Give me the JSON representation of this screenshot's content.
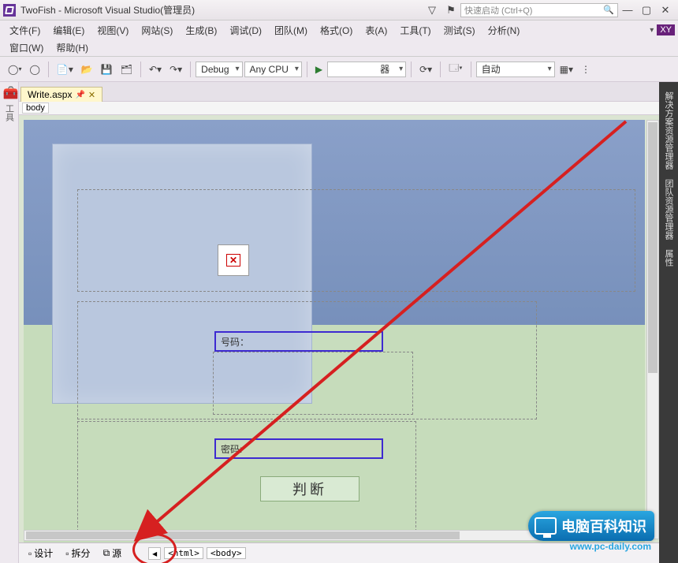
{
  "title": "TwoFish - Microsoft Visual Studio(管理员)",
  "quicklaunch_placeholder": "快速启动 (Ctrl+Q)",
  "menu": {
    "file": "文件(F)",
    "edit": "编辑(E)",
    "view": "视图(V)",
    "website": "网站(S)",
    "build": "生成(B)",
    "debug": "调试(D)",
    "team": "团队(M)",
    "format": "格式(O)",
    "table": "表(A)",
    "tools": "工具(T)",
    "test": "测试(S)",
    "analyze": "分析(N)",
    "window": "窗口(W)",
    "help": "帮助(H)"
  },
  "user_badge": "XY",
  "toolbar": {
    "config": "Debug",
    "platform": "Any CPU",
    "launch_suffix": "器",
    "auto": "自动"
  },
  "tab": {
    "name": "Write.aspx"
  },
  "breadcrumb": {
    "body": "body"
  },
  "form": {
    "number_label": "号码：",
    "password_label": "密码:",
    "submit_label": "判断"
  },
  "view_modes": {
    "design": "设计",
    "split": "拆分",
    "source": "源"
  },
  "tag_path": {
    "html": "<html>",
    "body": "<body>"
  },
  "left_label": "工具",
  "right_panels": {
    "p1": "解决方案资源管理器",
    "p2": "团队资源管理器",
    "p3": "属性"
  },
  "watermark": {
    "text": "电脑百科知识",
    "url": "www.pc-daily.com"
  }
}
